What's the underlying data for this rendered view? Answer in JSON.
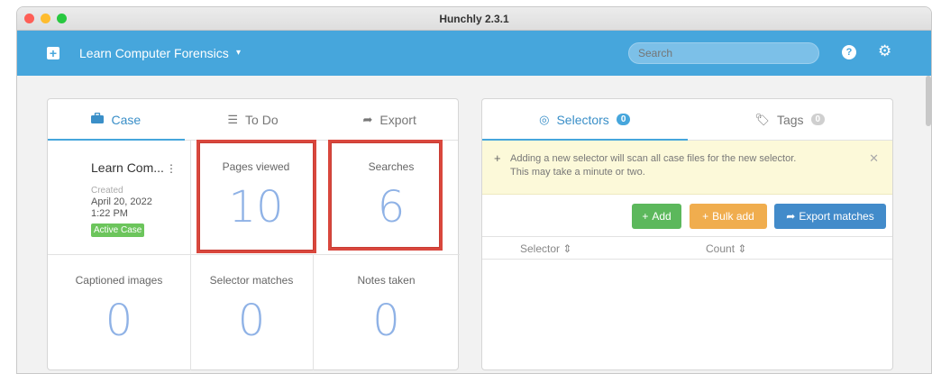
{
  "window": {
    "title": "Hunchly 2.3.1"
  },
  "appbar": {
    "case_name": "Learn Computer Forensics",
    "case_caret": "▾",
    "search_placeholder": "Search"
  },
  "left_tabs": [
    {
      "label": "Case",
      "icon": "briefcase-icon"
    },
    {
      "label": "To Do",
      "icon": "list-icon"
    },
    {
      "label": "Export",
      "icon": "share-icon"
    }
  ],
  "case": {
    "title": "Learn Com...",
    "created_label": "Created",
    "created_date": "April 20, 2022",
    "created_time": "1:22 PM",
    "status": "Active Case"
  },
  "stats": {
    "pages_viewed": {
      "label": "Pages viewed",
      "value": "10"
    },
    "searches": {
      "label": "Searches",
      "value": "6"
    },
    "captioned_images": {
      "label": "Captioned images",
      "value": "0"
    },
    "selector_matches": {
      "label": "Selector matches",
      "value": "0"
    },
    "notes_taken": {
      "label": "Notes taken",
      "value": "0"
    }
  },
  "right_tabs": [
    {
      "label": "Selectors",
      "count": "0",
      "icon": "target-icon"
    },
    {
      "label": "Tags",
      "count": "0",
      "icon": "tag-icon"
    }
  ],
  "notice": {
    "text": "Adding a new selector will scan all case files for the new selector. This may take a minute or two."
  },
  "buttons": {
    "add": "Add",
    "bulk_add": "Bulk add",
    "export_matches": "Export matches"
  },
  "table": {
    "col_selector": "Selector",
    "col_count": "Count"
  },
  "colors": {
    "accent": "#46a6dc",
    "highlight": "#d9473d",
    "add": "#5cb85c",
    "bulk": "#f0ad4e",
    "export": "#428bca"
  }
}
